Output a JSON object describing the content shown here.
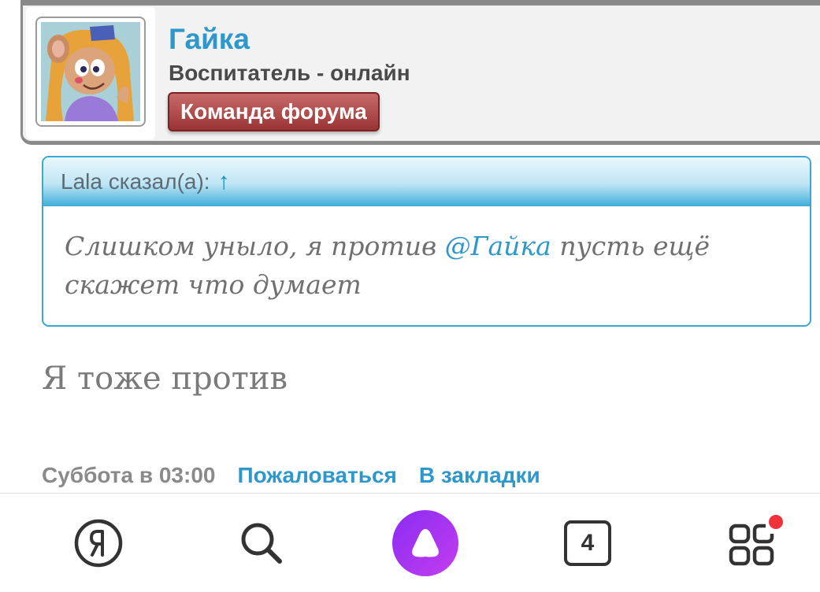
{
  "post": {
    "author": {
      "name": "Гайка",
      "title": "Воспитатель - онлайн",
      "badge": "Команда форума"
    },
    "quote": {
      "header": "Lala сказал(а):",
      "arrow": "↑",
      "text_before": "Слишком уныло, я против",
      "mention": "@Гайка",
      "text_after": "пусть ещё скажет что думает"
    },
    "body": "Я тоже против",
    "footer": {
      "date": "Суббота в 03:00",
      "report": "Пожаловаться",
      "bookmark": "В закладки"
    }
  },
  "bottom_nav": {
    "home_icon": "yandex-logo-icon",
    "search_icon": "search-icon",
    "assistant_icon": "alice-assistant-icon",
    "tabs_count": "4",
    "services_icon": "apps-grid-icon"
  },
  "colors": {
    "accent": "#2d98c9",
    "badge": "#a84040",
    "quote_border": "#3ba8d3",
    "notification_dot": "#f0333a",
    "assistant_gradient_start": "#8a2cf2",
    "assistant_gradient_end": "#c43df0"
  }
}
